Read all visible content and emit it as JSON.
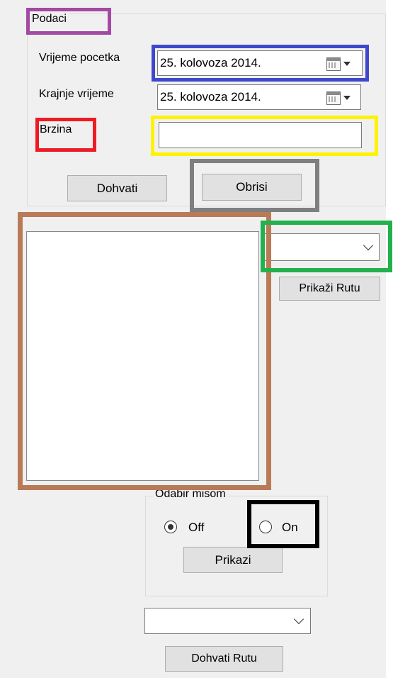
{
  "podaci": {
    "group_label": "Podaci",
    "start_label": "Vrijeme pocetka",
    "start_value": "25. kolovoza 2014.",
    "end_label": "Krajnje vrijeme",
    "end_value": "25. kolovoza 2014.",
    "speed_label": "Brzina",
    "speed_value": "",
    "fetch_button": "Dohvati",
    "delete_button": "Obrisi"
  },
  "route": {
    "combo_value": "",
    "show_route_button": "Prikaži Rutu"
  },
  "odabir": {
    "group_label": "Odabir misom",
    "off_label": "Off",
    "on_label": "On",
    "selected": "Off",
    "show_button": "Prikazi"
  },
  "bottom": {
    "combo_value": "",
    "fetch_route_button": "Dohvati Rutu"
  },
  "annotation_colors": {
    "purple": "#a349a4",
    "blue": "#3f48cc",
    "red": "#ed1c24",
    "yellow": "#fff200",
    "gray": "#7f7f7f",
    "brown": "#b97a57",
    "green": "#22b14c",
    "black": "#000000"
  }
}
